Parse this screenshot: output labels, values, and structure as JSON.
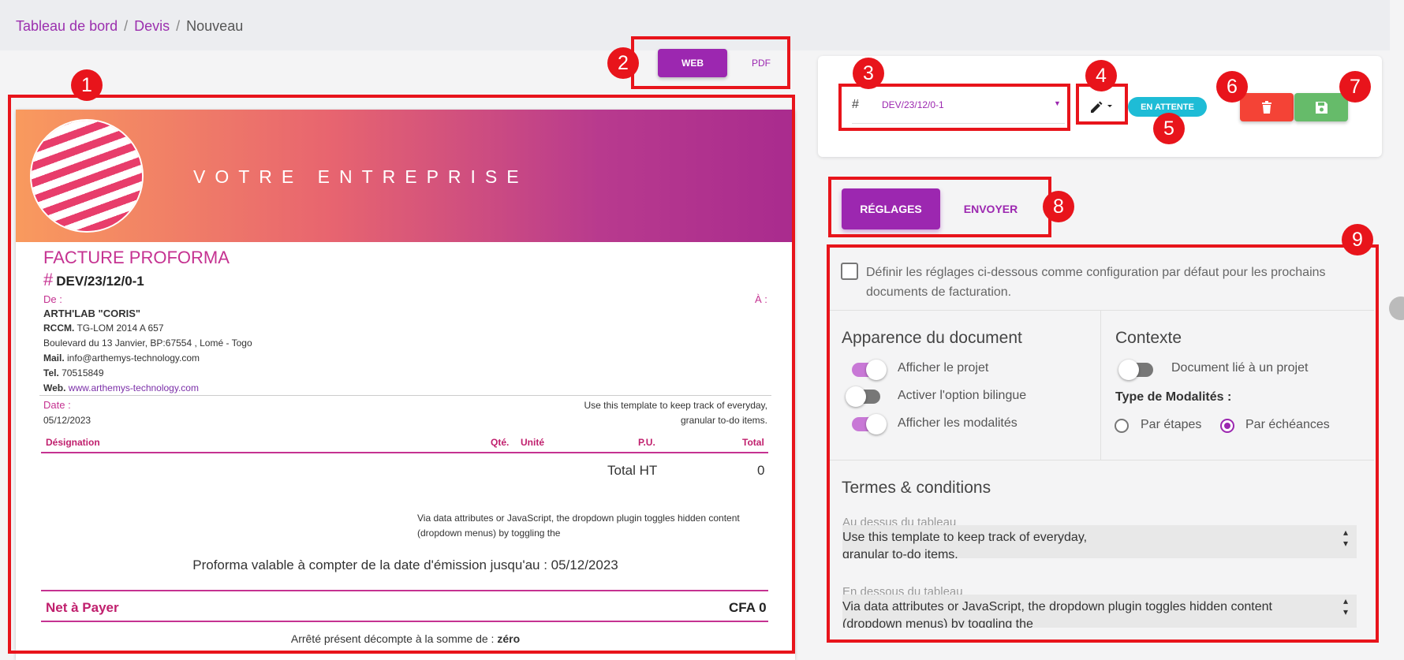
{
  "breadcrumb": {
    "items": [
      "Tableau de bord",
      "Devis"
    ],
    "current": "Nouveau"
  },
  "view_toggle": {
    "web": "WEB",
    "pdf": "PDF"
  },
  "badges": [
    "1",
    "2",
    "3",
    "4",
    "5",
    "6",
    "7",
    "8",
    "9"
  ],
  "document": {
    "company": "VOTRE ENTREPRISE",
    "title": "FACTURE PROFORMA",
    "hash": "#",
    "number": "DEV/23/12/0-1",
    "from_label": "De :",
    "to_label": "À :",
    "company_name": "ARTH'LAB \"CORIS\"",
    "rccm_label": "RCCM.",
    "rccm": "TG-LOM 2014 A 657",
    "address": "Boulevard du 13 Janvier, BP:67554 , Lomé - Togo",
    "mail_label": "Mail.",
    "mail": "info@arthemys-technology.com",
    "tel_label": "Tel.",
    "tel": "70515849",
    "web_label": "Web.",
    "web": "www.arthemys-technology.com",
    "date_label": "Date :",
    "date": "05/12/2023",
    "note_top_1": "Use this template to keep track of everyday,",
    "note_top_2": "granular to-do items.",
    "columns": {
      "designation": "Désignation",
      "qty": "Qté.",
      "unit": "Unité",
      "pu": "P.U.",
      "total": "Total"
    },
    "total_ht_label": "Total HT",
    "total_ht": "0",
    "note_bottom_1": "Via data attributes or JavaScript, the dropdown plugin toggles hidden content",
    "note_bottom_2": "(dropdown menus) by toggling the",
    "validity": "Proforma valable à compter de la date d'émission jusqu'au : 05/12/2023",
    "net_label": "Net à Payer",
    "net_value": "CFA 0",
    "arrete_prefix": "Arrêté présent décompte à la somme de :",
    "arrete_value": "zéro"
  },
  "toolbar": {
    "hash": "#",
    "number": "DEV/23/12/0-1",
    "status": "EN ATTENTE"
  },
  "tabs": {
    "settings": "RÉGLAGES",
    "send": "ENVOYER"
  },
  "settings": {
    "default_checkbox_label": "Définir les réglages ci-dessous comme configuration par défaut pour les prochains documents de facturation.",
    "appearance_title": "Apparence du document",
    "show_project": "Afficher le projet",
    "bilingual": "Activer l'option bilingue",
    "show_modalities": "Afficher les modalités",
    "context_title": "Contexte",
    "linked_project": "Document lié à un projet",
    "modality_type_label": "Type de Modalités :",
    "by_steps": "Par étapes",
    "by_deadlines": "Par échéances",
    "terms_title": "Termes & conditions",
    "above_label": "Au dessus du tableau",
    "above_value_1": "Use this template to keep track of everyday,",
    "above_value_2": "granular to-do items.",
    "below_label": "En dessous du tableau",
    "below_value_1": "Via data attributes or JavaScript, the dropdown plugin toggles hidden content",
    "below_value_2": "(dropdown menus) by toggling the"
  },
  "colors": {
    "accent": "#9c27b0",
    "pink": "#c53291",
    "annotation_red": "#e8141b",
    "status": "#1ebcd6",
    "delete": "#f44336",
    "save": "#66bb6a"
  },
  "icons": [
    "pencil-icon",
    "chevron-down-icon",
    "trash-icon",
    "save-icon",
    "help-icon"
  ]
}
